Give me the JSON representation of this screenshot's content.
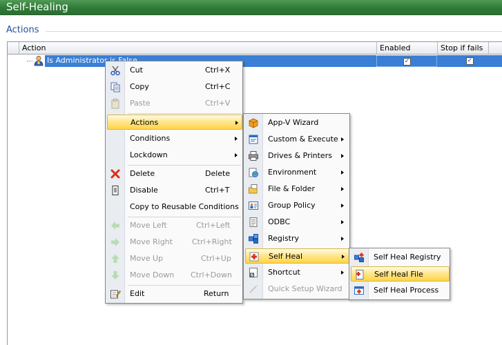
{
  "window": {
    "title": "Self-Healing"
  },
  "section": {
    "title": "Actions"
  },
  "grid": {
    "columns": [
      "Action",
      "Enabled",
      "Stop if fails"
    ],
    "rows": [
      {
        "label": "Is Administrator is False",
        "enabled": true,
        "stop_if_fails": true
      }
    ]
  },
  "context_menu": {
    "items": [
      {
        "label": "Cut",
        "shortcut": "Ctrl+X",
        "icon": "cut-icon",
        "enabled": true
      },
      {
        "label": "Copy",
        "shortcut": "Ctrl+C",
        "icon": "copy-icon",
        "enabled": true
      },
      {
        "label": "Paste",
        "shortcut": "Ctrl+V",
        "icon": "paste-icon",
        "enabled": false
      },
      {
        "label": "Actions",
        "submenu": true,
        "highlighted": true
      },
      {
        "label": "Conditions",
        "submenu": true
      },
      {
        "label": "Lockdown",
        "submenu": true
      },
      {
        "label": "Delete",
        "shortcut": "Delete",
        "icon": "delete-icon",
        "enabled": true
      },
      {
        "label": "Disable",
        "shortcut": "Ctrl+T",
        "icon": "disable-icon",
        "enabled": true
      },
      {
        "label": "Copy to Reusable Conditions",
        "enabled": true
      },
      {
        "label": "Move Left",
        "shortcut": "Ctrl+Left",
        "icon": "arrow-left-icon",
        "enabled": false
      },
      {
        "label": "Move Right",
        "shortcut": "Ctrl+Right",
        "icon": "arrow-right-icon",
        "enabled": false
      },
      {
        "label": "Move Up",
        "shortcut": "Ctrl+Up",
        "icon": "arrow-up-icon",
        "enabled": false
      },
      {
        "label": "Move Down",
        "shortcut": "Ctrl+Down",
        "icon": "arrow-down-icon",
        "enabled": false
      },
      {
        "label": "Edit",
        "shortcut": "Return",
        "icon": "edit-icon",
        "enabled": true
      }
    ]
  },
  "actions_menu": {
    "items": [
      {
        "label": "App-V Wizard",
        "icon": "appv-icon",
        "submenu": false
      },
      {
        "label": "Custom & Execute",
        "icon": "custom-execute-icon",
        "submenu": true
      },
      {
        "label": "Drives & Printers",
        "icon": "printer-icon",
        "submenu": true
      },
      {
        "label": "Environment",
        "icon": "environment-icon",
        "submenu": true
      },
      {
        "label": "File & Folder",
        "icon": "folder-icon",
        "submenu": true
      },
      {
        "label": "Group Policy",
        "icon": "group-policy-icon",
        "submenu": true
      },
      {
        "label": "ODBC",
        "icon": "odbc-icon",
        "submenu": true
      },
      {
        "label": "Registry",
        "icon": "registry-icon",
        "submenu": true
      },
      {
        "label": "Self Heal",
        "icon": "self-heal-icon",
        "submenu": true,
        "highlighted": true
      },
      {
        "label": "Shortcut",
        "icon": "shortcut-icon",
        "submenu": true
      },
      {
        "label": "Quick Setup Wizard",
        "icon": "wizard-icon",
        "enabled": false
      }
    ]
  },
  "self_heal_menu": {
    "items": [
      {
        "label": "Self Heal Registry",
        "icon": "self-heal-registry-icon"
      },
      {
        "label": "Self Heal File",
        "icon": "self-heal-file-icon",
        "highlighted": true
      },
      {
        "label": "Self Heal Process",
        "icon": "self-heal-process-icon"
      }
    ]
  },
  "colors": {
    "title_bar": "#2f7a37",
    "selection": "#3a7fd5",
    "menu_highlight": "#ffd545",
    "section_title": "#1f4f9e"
  }
}
